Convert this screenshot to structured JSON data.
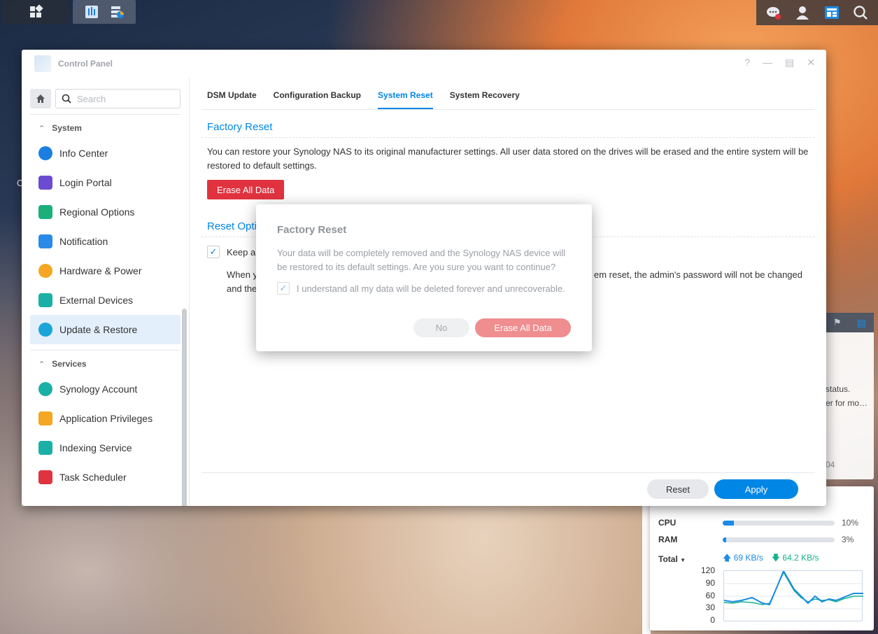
{
  "window": {
    "title": "Control Panel"
  },
  "sidebar": {
    "search_placeholder": "Search",
    "groups": [
      {
        "label": "System",
        "items": [
          {
            "label": "Info Center",
            "color": "#1a7fe0"
          },
          {
            "label": "Login Portal",
            "color": "#6b4bd2"
          },
          {
            "label": "Regional Options",
            "color": "#1bb07a"
          },
          {
            "label": "Notification",
            "color": "#2a8ae8"
          },
          {
            "label": "Hardware & Power",
            "color": "#f5a623"
          },
          {
            "label": "External Devices",
            "color": "#1bb0a5"
          },
          {
            "label": "Update & Restore",
            "color": "#1aa5d8"
          }
        ]
      },
      {
        "label": "Services",
        "items": [
          {
            "label": "Synology Account",
            "color": "#1bb0a5"
          },
          {
            "label": "Application Privileges",
            "color": "#f5a623"
          },
          {
            "label": "Indexing Service",
            "color": "#1bb0a5"
          },
          {
            "label": "Task Scheduler",
            "color": "#e0333f"
          }
        ]
      }
    ]
  },
  "tabs": [
    "DSM Update",
    "Configuration Backup",
    "System Reset",
    "System Recovery"
  ],
  "factory_reset": {
    "title": "Factory Reset",
    "description": "You can restore your Synology NAS to its original manufacturer settings. All user data stored on the drives will be erased and the entire system will be restored to default settings.",
    "button": "Erase All Data"
  },
  "reset_options": {
    "title": "Reset Opti",
    "keep_label": "Keep ac",
    "when_line1_left": "When y",
    "when_line1_right": "em reset, the admin's password will not be changed",
    "when_line2": "and the"
  },
  "footer": {
    "reset": "Reset",
    "apply": "Apply"
  },
  "modal": {
    "title": "Factory Reset",
    "text": "Your data will be completely removed and the Synology NAS device will be restored to its default settings. Are you sure you want to continue?",
    "checkbox_label": "I understand all my data will be deleted forever and unrecoverable.",
    "no": "No",
    "erase": "Erase All Data"
  },
  "widget_back": {
    "line1": "status.",
    "line2": "er for mo…",
    "line3": "04"
  },
  "resource_widget": {
    "cpu": {
      "label": "CPU",
      "value": "10%",
      "fraction": 0.1
    },
    "ram": {
      "label": "RAM",
      "value": "3%",
      "fraction": 0.03
    },
    "total_label": "Total",
    "up": "69 KB/s",
    "down": "64.2 KB/s",
    "yticks": [
      "120",
      "90",
      "60",
      "30",
      "0"
    ]
  },
  "desktop": {
    "partial_text": "C"
  }
}
